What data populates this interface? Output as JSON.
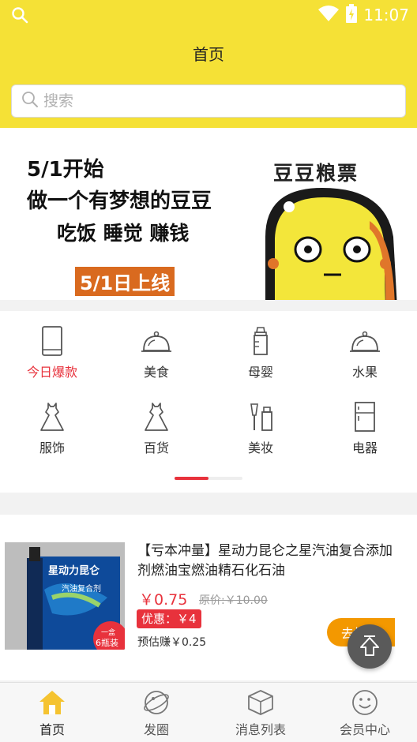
{
  "status_bar": {
    "time": "11:07"
  },
  "header": {
    "title": "首页"
  },
  "search": {
    "placeholder": "搜索"
  },
  "banner": {
    "line1": "5/1开始",
    "line2": "做一个有梦想的豆豆",
    "line3": "吃饭 睡觉 赚钱",
    "tag": "5/1日上线",
    "brand": "豆豆粮票"
  },
  "categories": [
    {
      "label": "今日爆款",
      "icon": "tablet-icon",
      "active": true
    },
    {
      "label": "美食",
      "icon": "cloche-icon"
    },
    {
      "label": "母婴",
      "icon": "baby-bottle-icon"
    },
    {
      "label": "水果",
      "icon": "cloche-icon"
    },
    {
      "label": "服饰",
      "icon": "dress-icon"
    },
    {
      "label": "百货",
      "icon": "dress-icon"
    },
    {
      "label": "美妆",
      "icon": "makeup-icon"
    },
    {
      "label": "电器",
      "icon": "fridge-icon"
    }
  ],
  "product": {
    "title": "【亏本冲量】星动力昆仑之星汽油复合添加剂燃油宝燃油精石化石油",
    "price": "￥0.75",
    "original_price": "原价:￥10.00",
    "coupon": "优惠：￥4",
    "estimated_earn": "预估赚￥0.25",
    "buy_label": "去抢",
    "image_text": {
      "brand": "星动力昆仑",
      "name": "汽油复合剂",
      "badge_top": "一盒",
      "badge_bottom": "6瓶装"
    }
  },
  "bottom_nav": [
    {
      "label": "首页",
      "icon": "home-icon",
      "active": true
    },
    {
      "label": "发圈",
      "icon": "planet-icon"
    },
    {
      "label": "消息列表",
      "icon": "box-icon"
    },
    {
      "label": "会员中心",
      "icon": "smiley-icon"
    }
  ],
  "colors": {
    "brand_yellow": "#f5e136",
    "accent_red": "#e8323c",
    "orange": "#f39800"
  }
}
